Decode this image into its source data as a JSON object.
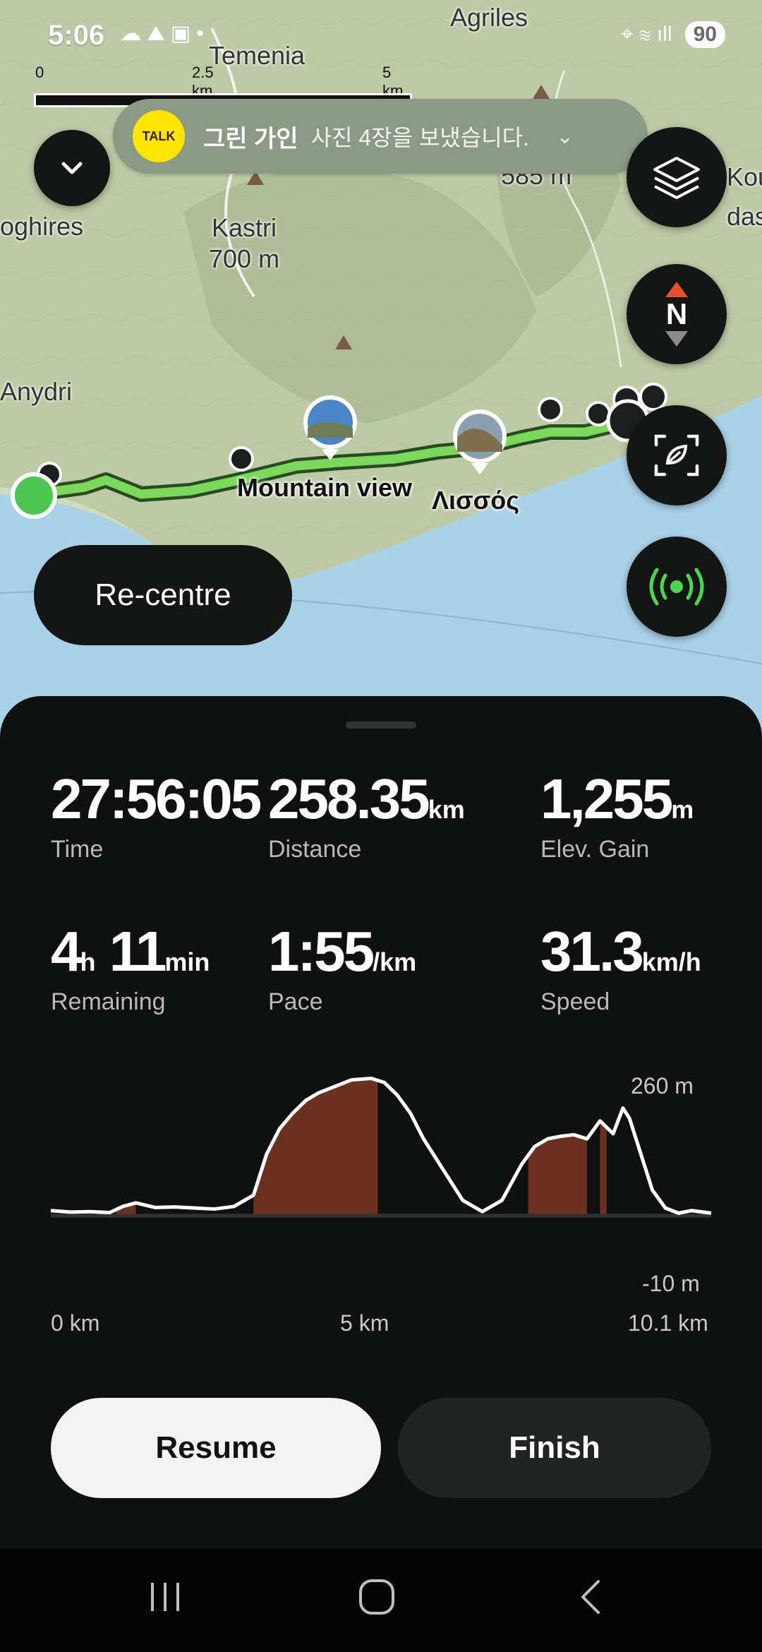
{
  "status_bar": {
    "time": "5:06",
    "battery": "90",
    "left_icons": "☁ ⛰ ▣ •",
    "right_icons": "⌖ ≋ ıll"
  },
  "map": {
    "scale": {
      "ticks": [
        "0",
        "2.5 km",
        "5 km"
      ]
    },
    "places": {
      "agriles": "Agriles",
      "temenia": "Temenia",
      "koughires": "oghires",
      "kastri": "Kastri",
      "kastri_elev": "700 m",
      "anydri": "Anydri",
      "elev585": "585 m",
      "koun": "Kou",
      "dasa": "dasa"
    },
    "poi": {
      "mountain_view": "Mountain view",
      "lissos": "Λισσός"
    },
    "recentre_label": "Re-centre",
    "colors": {
      "route": "#7bd85a",
      "route_border": "#2a4a24",
      "start": "#4cc552",
      "sea": "#a9d1e8",
      "land": "#c9d6b6"
    }
  },
  "notification": {
    "app_icon": "TALK",
    "sender": "그린 가인",
    "message": "사진 4장을 보냈습니다.",
    "chevron": "⌄"
  },
  "map_buttons": {
    "collapse_icon": "chevron-down-icon",
    "layers_icon": "layers-icon",
    "compass_icon": "compass-icon",
    "compass_letter": "N",
    "focus_icon": "focus-icon",
    "live_icon": "broadcast-icon"
  },
  "stats": [
    {
      "value": "27:56:05",
      "unit": "",
      "label": "Time"
    },
    {
      "value": "258.35",
      "unit": "km",
      "label": "Distance"
    },
    {
      "value": "1,255",
      "unit": "m",
      "label": "Elev. Gain"
    },
    {
      "value": "4",
      "unit": "h",
      "value2": "11",
      "unit2": "min",
      "label": "Remaining"
    },
    {
      "value": "1:55",
      "unit": "/km",
      "label": "Pace"
    },
    {
      "value": "31.3",
      "unit": "km/h",
      "label": "Speed"
    }
  ],
  "chart_data": {
    "type": "area",
    "title": "",
    "xlabel": "",
    "ylabel": "",
    "xlim": [
      0,
      10.1
    ],
    "ylim": [
      -10,
      260
    ],
    "x_ticks": [
      "0 km",
      "5 km",
      "10.1 km"
    ],
    "y_ticks": [
      "260 m",
      "-10 m"
    ],
    "x": [
      0,
      0.3,
      0.6,
      0.9,
      1.1,
      1.3,
      1.6,
      1.9,
      2.2,
      2.5,
      2.8,
      3.1,
      3.3,
      3.5,
      3.7,
      3.9,
      4.1,
      4.3,
      4.6,
      4.9,
      5.1,
      5.3,
      5.5,
      5.7,
      6.0,
      6.3,
      6.6,
      6.9,
      7.2,
      7.4,
      7.6,
      7.8,
      8.0,
      8.2,
      8.4,
      8.6,
      8.75,
      8.85,
      9.0,
      9.2,
      9.4,
      9.6,
      9.8,
      10.1
    ],
    "values": [
      0,
      -3,
      -2,
      -4,
      8,
      15,
      6,
      7,
      5,
      3,
      8,
      30,
      110,
      160,
      190,
      215,
      230,
      240,
      255,
      258,
      250,
      225,
      190,
      140,
      80,
      20,
      -2,
      20,
      90,
      125,
      140,
      145,
      148,
      140,
      175,
      150,
      200,
      180,
      120,
      40,
      5,
      -5,
      0,
      -5
    ],
    "climb_segments": [
      [
        1.0,
        1.3
      ],
      [
        3.1,
        5.0
      ],
      [
        7.3,
        8.2
      ],
      [
        8.4,
        8.5
      ]
    ],
    "colors": {
      "line": "#ffffff",
      "climb": "#6b3020",
      "baseline": "#333333"
    }
  },
  "buttons": {
    "resume": "Resume",
    "finish": "Finish"
  },
  "nav": {
    "recents": "recents-icon",
    "home": "home-icon",
    "back": "back-icon"
  }
}
